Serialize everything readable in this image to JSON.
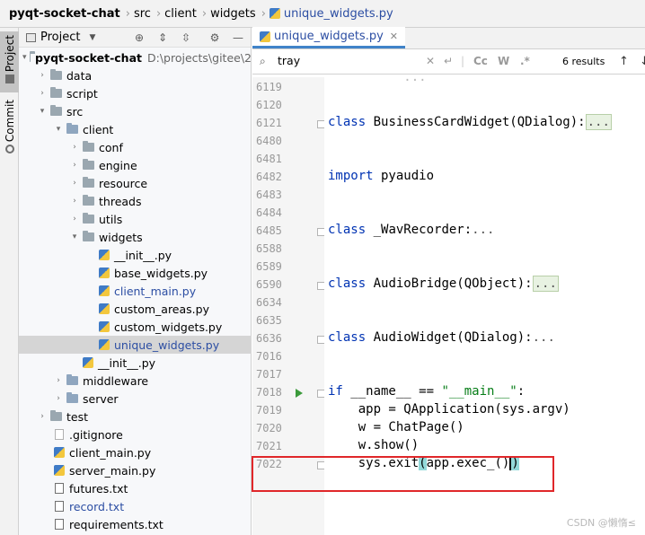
{
  "breadcrumb": {
    "project": "pyqt-socket-chat",
    "items": [
      "src",
      "client",
      "widgets"
    ],
    "file": "unique_widgets.py"
  },
  "toolstrip": {
    "project_tab": "Project",
    "commit_tab": "Commit"
  },
  "project_panel": {
    "title": "Project",
    "tree": [
      {
        "label": "pyqt-socket-chat",
        "path": "D:\\projects\\gitee\\2",
        "type": "root"
      },
      {
        "label": "data",
        "type": "folder"
      },
      {
        "label": "script",
        "type": "folder"
      },
      {
        "label": "src",
        "type": "folder"
      },
      {
        "label": "client",
        "type": "folder"
      },
      {
        "label": "conf",
        "type": "folder"
      },
      {
        "label": "engine",
        "type": "folder"
      },
      {
        "label": "resource",
        "type": "folder"
      },
      {
        "label": "threads",
        "type": "folder"
      },
      {
        "label": "utils",
        "type": "folder"
      },
      {
        "label": "widgets",
        "type": "folder"
      },
      {
        "label": "__init__.py",
        "type": "py"
      },
      {
        "label": "base_widgets.py",
        "type": "py"
      },
      {
        "label": "client_main.py",
        "type": "py"
      },
      {
        "label": "custom_areas.py",
        "type": "py"
      },
      {
        "label": "custom_widgets.py",
        "type": "py"
      },
      {
        "label": "unique_widgets.py",
        "type": "py"
      },
      {
        "label": "__init__.py",
        "type": "py"
      },
      {
        "label": "middleware",
        "type": "folder"
      },
      {
        "label": "server",
        "type": "folder"
      },
      {
        "label": "test",
        "type": "folder"
      },
      {
        "label": ".gitignore",
        "type": "git"
      },
      {
        "label": "client_main.py",
        "type": "py"
      },
      {
        "label": "server_main.py",
        "type": "py"
      },
      {
        "label": "futures.txt",
        "type": "txt"
      },
      {
        "label": "record.txt",
        "type": "txt"
      },
      {
        "label": "requirements.txt",
        "type": "txt"
      }
    ]
  },
  "editor": {
    "tab_label": "unique_widgets.py",
    "find": {
      "query": "tray",
      "results": "6 results",
      "cc": "Cc",
      "w": "W",
      "regex": ".*"
    },
    "line_numbers": [
      "6119",
      "6120",
      "6121",
      "6480",
      "6481",
      "6482",
      "6483",
      "6484",
      "6485",
      "6588",
      "6589",
      "6590",
      "6634",
      "6635",
      "6636",
      "7016",
      "7017",
      "7018",
      "7019",
      "7020",
      "7021",
      "7022"
    ],
    "code": {
      "l6121_kw": "class",
      "l6121_rest": " BusinessCardWidget(QDialog):",
      "l6482_kw": "import",
      "l6482_rest": " pyaudio",
      "l6485_kw": "class",
      "l6485_rest": " _WavRecorder:",
      "l6590_kw": "class",
      "l6590_rest": " AudioBridge(QObject):",
      "l6636_kw": "class",
      "l6636_rest": " AudioWidget(QDialog):",
      "l7018_kw": "if",
      "l7018_mid": " __name__ == ",
      "l7018_str": "\"__main__\"",
      "l7018_end": ":",
      "l7019": "    app = QApplication(sys.argv)",
      "l7020": "    w = ChatPage()",
      "l7021": "    w.show()",
      "l7022_a": "    sys.exit",
      "l7022_b": "(",
      "l7022_c": "app.exec_()",
      "l7022_d": ")",
      "ellipsis": "..."
    }
  },
  "watermark": "CSDN @懒惰≤"
}
